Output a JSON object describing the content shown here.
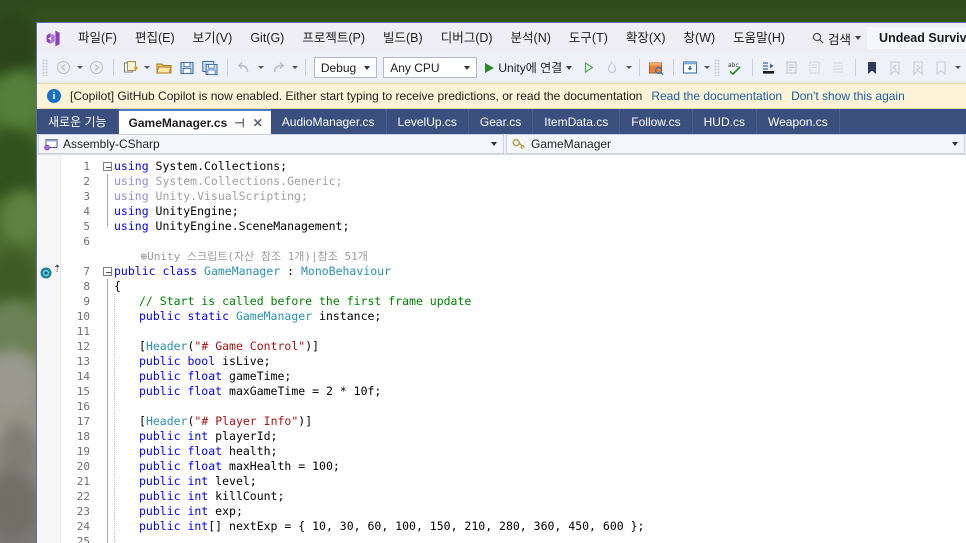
{
  "window": {
    "title": "Undead Survivor"
  },
  "menubar": {
    "logo_icon": "visual-studio-logo",
    "items": [
      {
        "label": "파일(F)"
      },
      {
        "label": "편집(E)"
      },
      {
        "label": "보기(V)"
      },
      {
        "label": "Git(G)"
      },
      {
        "label": "프로젝트(P)"
      },
      {
        "label": "빌드(B)"
      },
      {
        "label": "디버그(D)"
      },
      {
        "label": "분석(N)"
      },
      {
        "label": "도구(T)"
      },
      {
        "label": "확장(X)"
      },
      {
        "label": "창(W)"
      },
      {
        "label": "도움말(H)"
      }
    ],
    "search": {
      "label": "검색",
      "icon": "search-icon"
    },
    "project_name": "Undead Survivor"
  },
  "toolbar": {
    "back_icon": "navigate-back-icon",
    "forward_icon": "navigate-forward-icon",
    "new_icon": "new-project-icon",
    "open_icon": "open-file-icon",
    "save_icon": "save-icon",
    "save_all_icon": "save-all-icon",
    "undo_icon": "undo-icon",
    "redo_icon": "redo-icon",
    "configuration": "Debug",
    "platform": "Any CPU",
    "run_label": "Unity에 연결",
    "run_icon": "play-icon",
    "attach_icon": "play-hollow-icon",
    "hotreload_icon": "hot-reload-icon",
    "solution_explorer_icon": "solution-explorer-icon",
    "window_icon": "window-layout-icon",
    "spellcheck_icon": "spellcheck-icon",
    "indent_icon": "indent-icon",
    "comment_icon": "comment-icon",
    "uncomment_icon": "uncomment-icon",
    "outdent_icon": "outdent-icon",
    "bookmark_icon": "bookmark-icon",
    "bookmark_prev_icon": "bookmark-previous-icon",
    "bookmark_next_icon": "bookmark-next-icon",
    "bookmark_clear_icon": "bookmark-clear-icon",
    "overflow_icon": "toolbar-overflow-icon"
  },
  "notification": {
    "icon": "info-icon",
    "icon_glyph": "i",
    "message": "[Copilot] GitHub Copilot is now enabled. Either start typing to receive predictions, or read the documentation",
    "link_docs": "Read the documentation",
    "link_dismiss": "Don't show this again"
  },
  "tabs": [
    {
      "label": "새로운 기능",
      "active": false
    },
    {
      "label": "GameManager.cs",
      "active": true,
      "pin_icon": "pin-icon",
      "close_icon": "close-icon",
      "pin_glyph": "⊣",
      "close_glyph": "✕"
    },
    {
      "label": "AudioManager.cs",
      "active": false
    },
    {
      "label": "LevelUp.cs",
      "active": false
    },
    {
      "label": "Gear.cs",
      "active": false
    },
    {
      "label": "ItemData.cs",
      "active": false
    },
    {
      "label": "Follow.cs",
      "active": false
    },
    {
      "label": "HUD.cs",
      "active": false
    },
    {
      "label": "Weapon.cs",
      "active": false
    }
  ],
  "navbar": {
    "project": "Assembly-CSharp",
    "project_icon": "project-icon",
    "class": "GameManager",
    "class_icon": "class-icon"
  },
  "editor": {
    "codelens": "Unity 스크립트(자산 참조 1개)|참조 51개",
    "codelens_icon": "unity-codelens-icon",
    "glyph_icon": "unity-script-glyph-icon",
    "lines": [
      {
        "n": "1",
        "fold": "open",
        "segments": [
          {
            "t": "using ",
            "c": "kw"
          },
          {
            "t": "System.Collections;",
            "c": "pln"
          }
        ]
      },
      {
        "n": "2",
        "fold": "bar",
        "segments": [
          {
            "t": "using ",
            "c": "graykw"
          },
          {
            "t": "System.Collections.Generic;",
            "c": "gray"
          }
        ]
      },
      {
        "n": "3",
        "fold": "bar",
        "segments": [
          {
            "t": "using ",
            "c": "graykw"
          },
          {
            "t": "Unity.VisualScripting;",
            "c": "gray"
          }
        ]
      },
      {
        "n": "4",
        "fold": "bar",
        "segments": [
          {
            "t": "using ",
            "c": "kw"
          },
          {
            "t": "UnityEngine;",
            "c": "pln"
          }
        ]
      },
      {
        "n": "5",
        "fold": "end",
        "segments": [
          {
            "t": "using ",
            "c": "kw"
          },
          {
            "t": "UnityEngine.SceneManagement;",
            "c": "pln"
          }
        ]
      },
      {
        "n": "6",
        "fold": "none",
        "segments": []
      },
      {
        "n": "",
        "fold": "none",
        "codelens": true
      },
      {
        "n": "7",
        "fold": "open",
        "glyph": true,
        "segments": [
          {
            "t": "public class ",
            "c": "kw"
          },
          {
            "t": "GameManager",
            "c": "typ"
          },
          {
            "t": " : ",
            "c": "pln"
          },
          {
            "t": "MonoBehaviour",
            "c": "typ"
          }
        ]
      },
      {
        "n": "8",
        "fold": "bar",
        "segments": [
          {
            "t": "{",
            "c": "pln"
          }
        ]
      },
      {
        "n": "9",
        "fold": "bar",
        "indent": 1,
        "segments": [
          {
            "t": "// Start is called before the first frame update",
            "c": "com"
          }
        ]
      },
      {
        "n": "10",
        "fold": "bar",
        "indent": 1,
        "segments": [
          {
            "t": "public static ",
            "c": "kw"
          },
          {
            "t": "GameManager",
            "c": "typ"
          },
          {
            "t": " instance;",
            "c": "pln"
          }
        ]
      },
      {
        "n": "11",
        "fold": "bar",
        "indent": 1,
        "segments": []
      },
      {
        "n": "12",
        "fold": "bar",
        "indent": 1,
        "segments": [
          {
            "t": "[",
            "c": "pln"
          },
          {
            "t": "Header",
            "c": "attr"
          },
          {
            "t": "(",
            "c": "pln"
          },
          {
            "t": "\"# Game Control\"",
            "c": "str"
          },
          {
            "t": ")]",
            "c": "pln"
          }
        ]
      },
      {
        "n": "13",
        "fold": "bar",
        "indent": 1,
        "segments": [
          {
            "t": "public bool ",
            "c": "kw"
          },
          {
            "t": "isLive;",
            "c": "pln"
          }
        ]
      },
      {
        "n": "14",
        "fold": "bar",
        "indent": 1,
        "segments": [
          {
            "t": "public float ",
            "c": "kw"
          },
          {
            "t": "gameTime;",
            "c": "pln"
          }
        ]
      },
      {
        "n": "15",
        "fold": "bar",
        "indent": 1,
        "segments": [
          {
            "t": "public float ",
            "c": "kw"
          },
          {
            "t": "maxGameTime = 2 * 10f;",
            "c": "pln"
          }
        ]
      },
      {
        "n": "16",
        "fold": "bar",
        "indent": 1,
        "segments": []
      },
      {
        "n": "17",
        "fold": "bar",
        "indent": 1,
        "segments": [
          {
            "t": "[",
            "c": "pln"
          },
          {
            "t": "Header",
            "c": "attr"
          },
          {
            "t": "(",
            "c": "pln"
          },
          {
            "t": "\"# Player Info\"",
            "c": "str"
          },
          {
            "t": ")]",
            "c": "pln"
          }
        ]
      },
      {
        "n": "18",
        "fold": "bar",
        "indent": 1,
        "segments": [
          {
            "t": "public int ",
            "c": "kw"
          },
          {
            "t": "playerId;",
            "c": "pln"
          }
        ]
      },
      {
        "n": "19",
        "fold": "bar",
        "indent": 1,
        "segments": [
          {
            "t": "public float ",
            "c": "kw"
          },
          {
            "t": "health;",
            "c": "pln"
          }
        ]
      },
      {
        "n": "20",
        "fold": "bar",
        "indent": 1,
        "segments": [
          {
            "t": "public float ",
            "c": "kw"
          },
          {
            "t": "maxHealth = 100;",
            "c": "pln"
          }
        ]
      },
      {
        "n": "21",
        "fold": "bar",
        "indent": 1,
        "segments": [
          {
            "t": "public int ",
            "c": "kw"
          },
          {
            "t": "level;",
            "c": "pln"
          }
        ]
      },
      {
        "n": "22",
        "fold": "bar",
        "indent": 1,
        "segments": [
          {
            "t": "public int ",
            "c": "kw"
          },
          {
            "t": "killCount;",
            "c": "pln"
          }
        ]
      },
      {
        "n": "23",
        "fold": "bar",
        "indent": 1,
        "segments": [
          {
            "t": "public int ",
            "c": "kw"
          },
          {
            "t": "exp;",
            "c": "pln"
          }
        ]
      },
      {
        "n": "24",
        "fold": "bar",
        "indent": 1,
        "segments": [
          {
            "t": "public int",
            "c": "kw"
          },
          {
            "t": "[] nextExp = { 10, 30, 60, 100, 150, 210, 280, 360, 450, 600 };",
            "c": "pln"
          }
        ]
      },
      {
        "n": "25",
        "fold": "bar",
        "indent": 1,
        "segments": []
      }
    ]
  },
  "colors": {
    "accent": "#3a4f7e",
    "titlebar": "#eeeef4",
    "toolbar": "#eef1f7",
    "notification_bg": "#fdf3d6",
    "keyword": "#0000ff",
    "type": "#2b91af",
    "string": "#a31515",
    "comment": "#008000"
  }
}
